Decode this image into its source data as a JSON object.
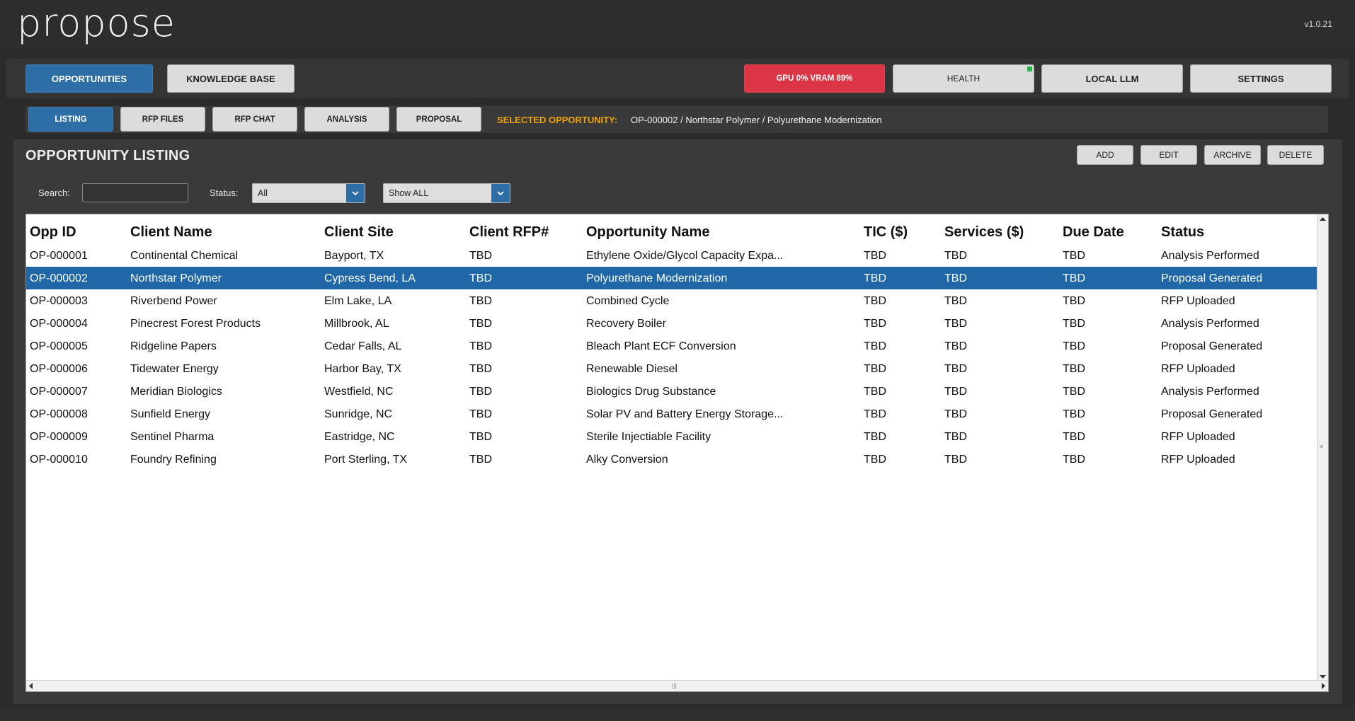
{
  "app": {
    "logo": "propose",
    "version": "v1.0.21"
  },
  "topnav": {
    "opportunities": "OPPORTUNITIES",
    "knowledge_base": "KNOWLEDGE BASE",
    "gpu_status": "GPU 0%  VRAM 89%",
    "health": "HEALTH",
    "local_llm": "LOCAL LLM",
    "settings": "SETTINGS"
  },
  "subnav": {
    "listing": "LISTING",
    "rfp_files": "RFP FILES",
    "rfp_chat": "RFP CHAT",
    "analysis": "ANALYSIS",
    "proposal": "PROPOSAL",
    "selected_label": "SELECTED OPPORTUNITY:",
    "selected_value": "OP-000002 / Northstar Polymer / Polyurethane Modernization"
  },
  "panel": {
    "title": "OPPORTUNITY LISTING",
    "actions": {
      "add": "ADD",
      "edit": "EDIT",
      "archive": "ARCHIVE",
      "delete": "DELETE"
    },
    "filters": {
      "search_label": "Search:",
      "search_value": "",
      "status_label": "Status:",
      "status_value": "All",
      "show_value": "Show ALL"
    }
  },
  "table": {
    "headers": [
      "Opp ID",
      "Client Name",
      "Client Site",
      "Client RFP#",
      "Opportunity Name",
      "TIC ($)",
      "Services ($)",
      "Due Date",
      "Status"
    ],
    "rows": [
      [
        "OP-000001",
        "Continental Chemical",
        "Bayport, TX",
        "TBD",
        "Ethylene Oxide/Glycol Capacity Expa...",
        "TBD",
        "TBD",
        "TBD",
        "Analysis Performed"
      ],
      [
        "OP-000002",
        "Northstar Polymer",
        "Cypress Bend, LA",
        "TBD",
        "Polyurethane Modernization",
        "TBD",
        "TBD",
        "TBD",
        "Proposal Generated"
      ],
      [
        "OP-000003",
        "Riverbend Power",
        "Elm Lake, LA",
        "TBD",
        "Combined Cycle",
        "TBD",
        "TBD",
        "TBD",
        "RFP Uploaded"
      ],
      [
        "OP-000004",
        "Pinecrest Forest Products",
        "Millbrook, AL",
        "TBD",
        "Recovery Boiler",
        "TBD",
        "TBD",
        "TBD",
        "Analysis Performed"
      ],
      [
        "OP-000005",
        "Ridgeline Papers",
        "Cedar Falls, AL",
        "TBD",
        "Bleach Plant ECF Conversion",
        "TBD",
        "TBD",
        "TBD",
        "Proposal Generated"
      ],
      [
        "OP-000006",
        "Tidewater Energy",
        "Harbor Bay, TX",
        "TBD",
        "Renewable Diesel",
        "TBD",
        "TBD",
        "TBD",
        "RFP Uploaded"
      ],
      [
        "OP-000007",
        "Meridian Biologics",
        "Westfield, NC",
        "TBD",
        "Biologics Drug Substance",
        "TBD",
        "TBD",
        "TBD",
        "Analysis Performed"
      ],
      [
        "OP-000008",
        "Sunfield Energy",
        "Sunridge, NC",
        "TBD",
        "Solar PV and Battery Energy Storage...",
        "TBD",
        "TBD",
        "TBD",
        "Proposal Generated"
      ],
      [
        "OP-000009",
        "Sentinel Pharma",
        "Eastridge, NC",
        "TBD",
        "Sterile Injectiable Facility",
        "TBD",
        "TBD",
        "TBD",
        "RFP Uploaded"
      ],
      [
        "OP-000010",
        "Foundry Refining",
        "Port Sterling, TX",
        "TBD",
        "Alky Conversion",
        "TBD",
        "TBD",
        "TBD",
        "RFP Uploaded"
      ]
    ],
    "selected_row": 1
  },
  "colors": {
    "accent_blue": "#2e6ea6",
    "selected_row": "#1f67a6",
    "gpu_red": "#dc3545",
    "selected_label": "#f0a30a",
    "health_ok": "#26b34a"
  },
  "icons": {
    "dropdown": "chevron-down-icon",
    "health_indicator": "status-dot-icon"
  }
}
